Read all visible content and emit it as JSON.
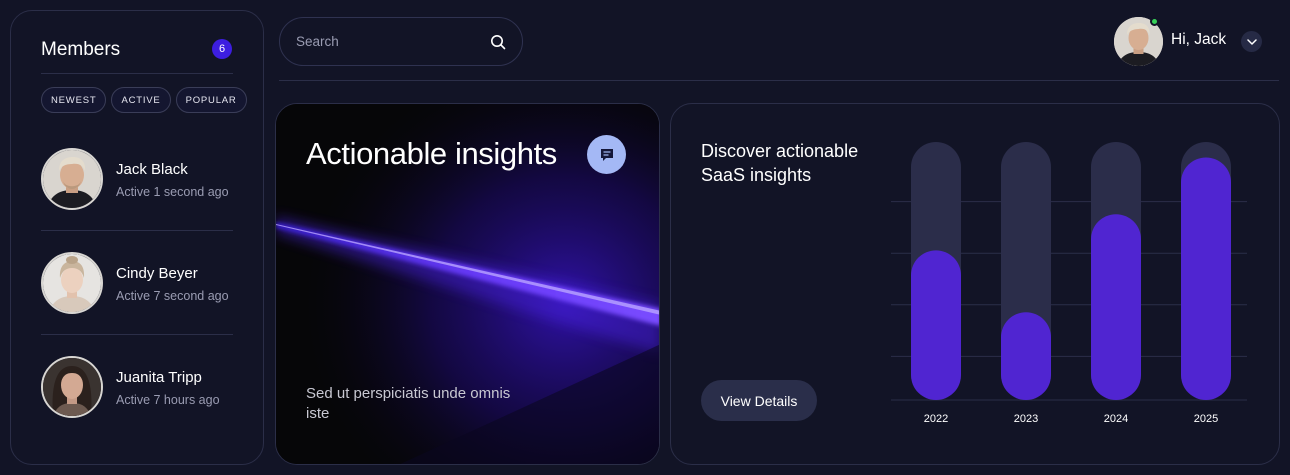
{
  "members": {
    "title": "Members",
    "count": "6",
    "filters": [
      "NEWEST",
      "ACTIVE",
      "POPULAR"
    ],
    "list": [
      {
        "name": "Jack Black",
        "status": "Active 1 second ago"
      },
      {
        "name": "Cindy Beyer",
        "status": "Active 7 second ago"
      },
      {
        "name": "Juanita Tripp",
        "status": "Active 7 hours ago"
      }
    ]
  },
  "search": {
    "placeholder": "Search",
    "icon": "search-icon"
  },
  "user": {
    "greeting": "Hi, Jack",
    "online": true
  },
  "hero": {
    "title": "Actionable insights",
    "subtitle": "Sed ut perspiciatis unde omnis iste",
    "badge_icon": "chat-icon"
  },
  "insights": {
    "title": "Discover actionable SaaS insights",
    "button": "View Details"
  },
  "colors": {
    "background": "#121426",
    "accent": "#5025d1",
    "track": "#2b2d4a",
    "badge": "#3d1ee0",
    "online": "#37d158"
  },
  "chart_data": {
    "type": "bar",
    "categories": [
      "2022",
      "2023",
      "2024",
      "2025"
    ],
    "values": [
      58,
      34,
      72,
      94
    ],
    "ylim": [
      0,
      100
    ],
    "grid": true
  }
}
